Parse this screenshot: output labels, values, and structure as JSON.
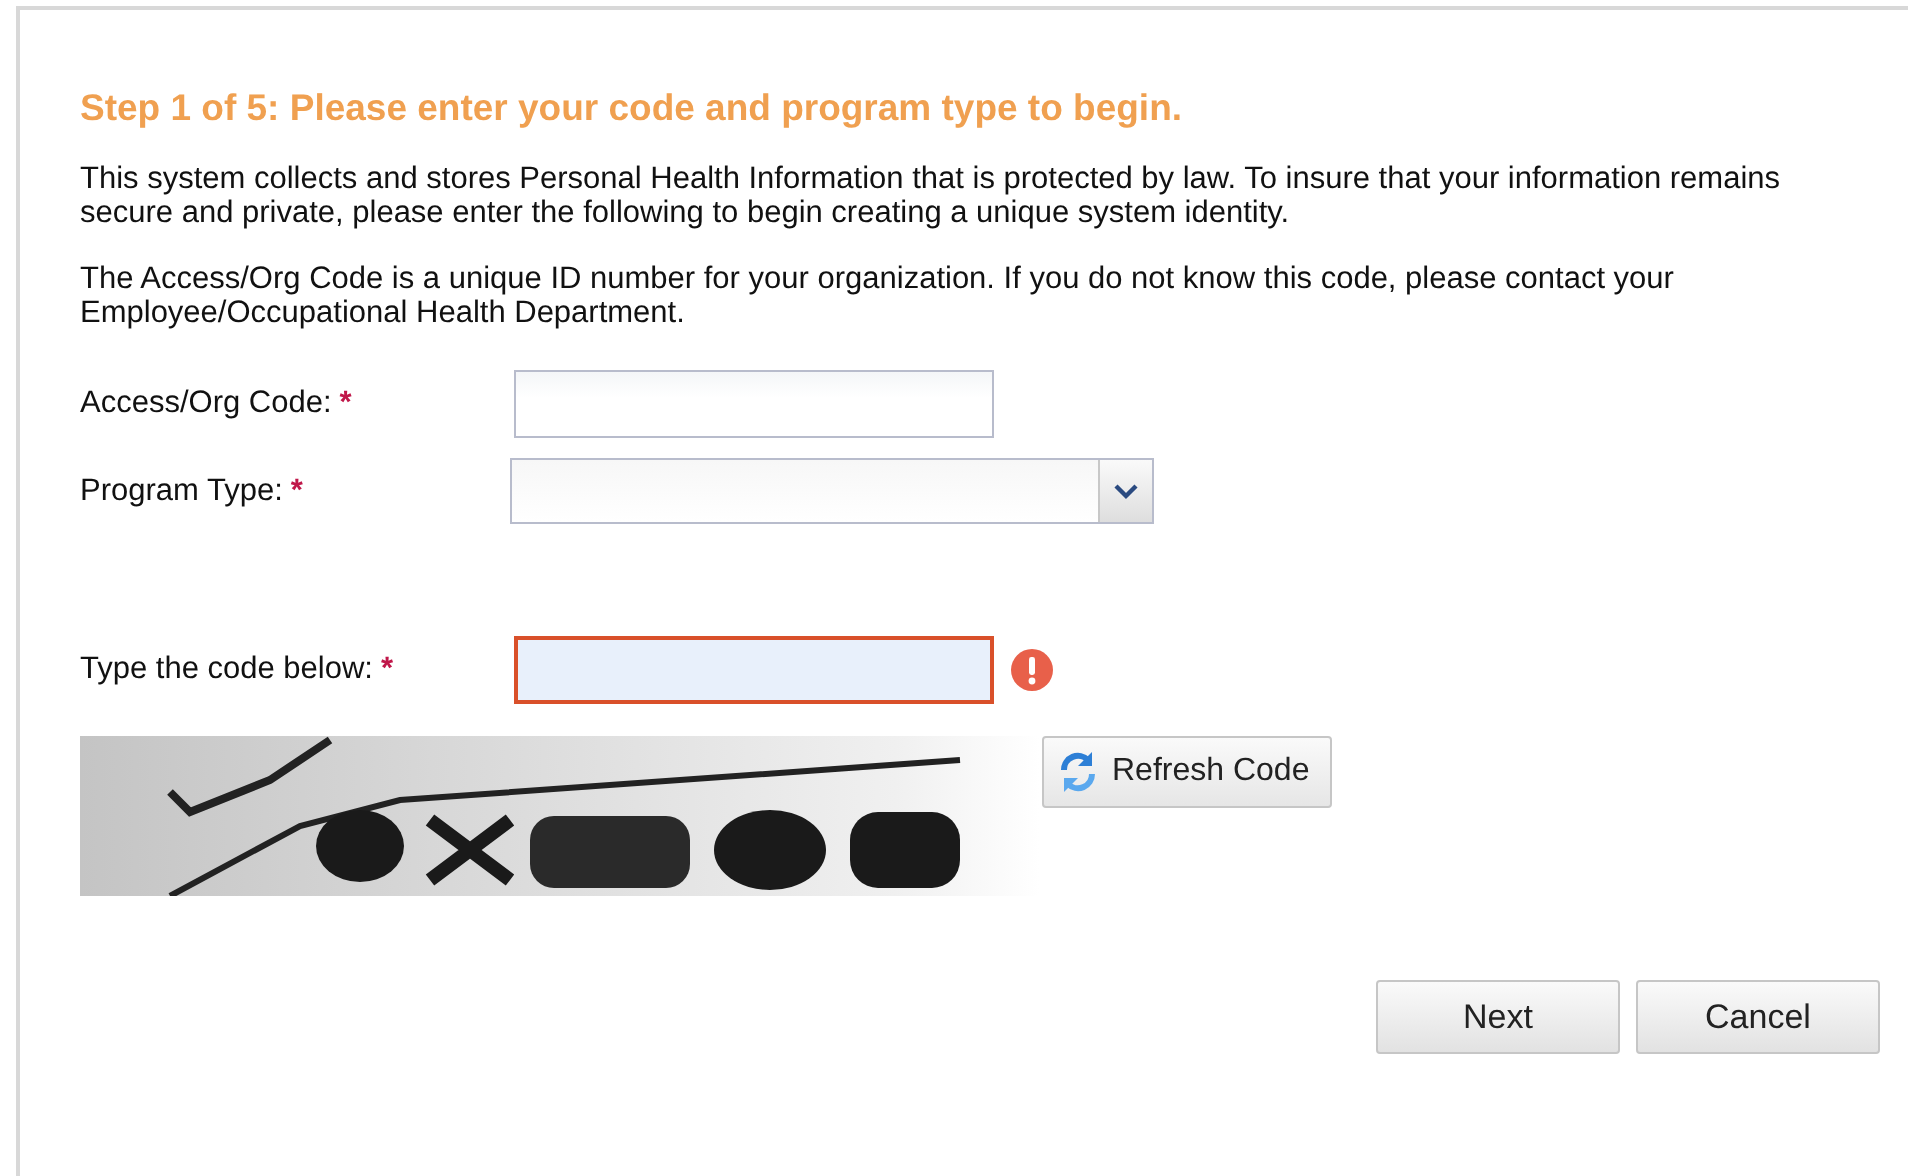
{
  "heading": "Step 1 of 5: Please enter your code and program type to begin.",
  "paragraphs": [
    "This system collects and stores Personal Health Information that is protected by law. To insure that your information remains secure and private, please enter the following to begin creating a unique system identity.",
    "The Access/Org Code is a unique ID number for your organization. If you do not know this code, please contact your Employee/Occupational Health Department."
  ],
  "fields": [
    {
      "kind": "text",
      "label": "Access/Org Code:",
      "required_mark": "*",
      "invalid": false
    },
    {
      "kind": "select",
      "label": "Program Type:",
      "required_mark": "*",
      "invalid": false
    },
    {
      "kind": "captcha_input",
      "label": "Type the code below:",
      "required_mark": "*",
      "invalid": true
    }
  ],
  "captcha": {
    "kind": "picture"
  },
  "refresh_button": "Refresh Code",
  "buttons": [
    "Next",
    "Cancel"
  ]
}
